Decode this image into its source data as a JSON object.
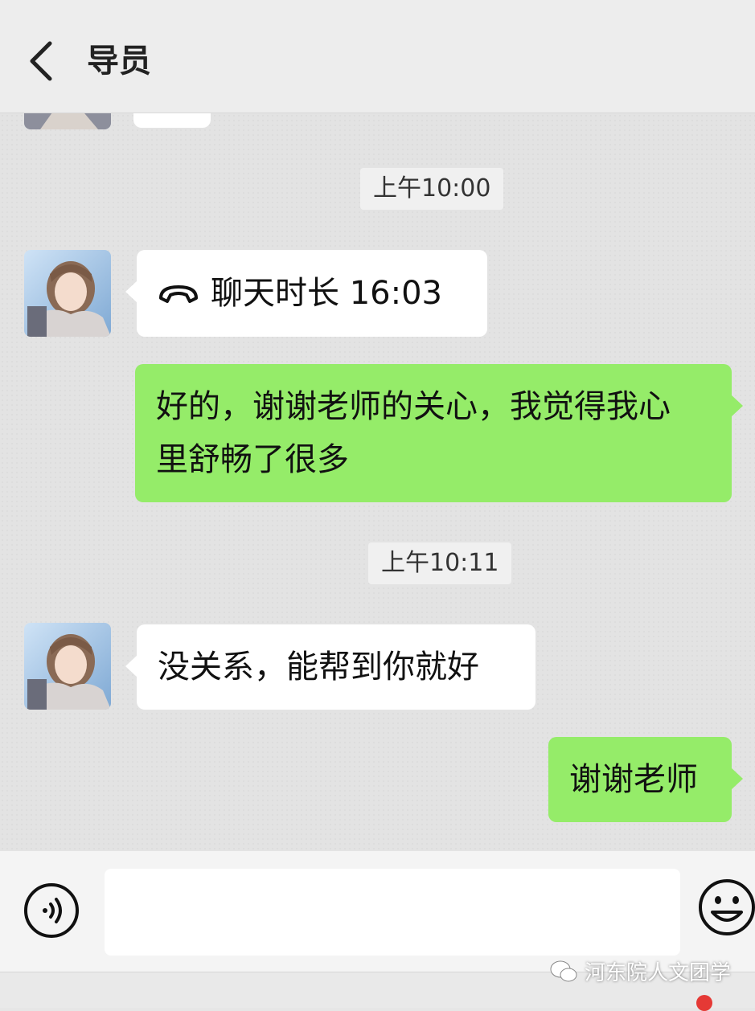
{
  "header": {
    "title": "导员"
  },
  "messages": {
    "time_1": "上午10:00",
    "call_text": "聊天时长 16:03",
    "out_1_line1": "好的，谢谢老师的关心，我觉得我心",
    "out_1_line2": "里舒畅了很多",
    "time_2": "上午10:11",
    "in_2": "没关系，能帮到你就好",
    "out_2": "谢谢老师"
  },
  "input_bar": {
    "placeholder": ""
  },
  "icons": {
    "back": "chevron-left-icon",
    "call": "phone-hangup-icon",
    "voice": "voice-icon",
    "emoji": "smiley-icon",
    "watermark_logo": "wechat-logo-icon"
  },
  "colors": {
    "outgoing_bubble": "#95ec69",
    "incoming_bubble": "#ffffff",
    "chat_background": "#e3e3e3",
    "badge": "#e53935"
  },
  "watermark": {
    "text": "河东院人文团学"
  }
}
